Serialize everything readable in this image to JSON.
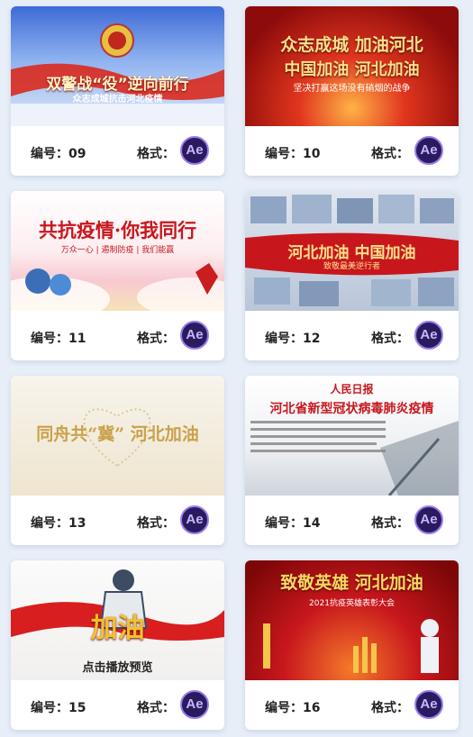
{
  "labels": {
    "number_prefix": "编号：",
    "format_label": "格式：",
    "format_badge": "Ae"
  },
  "cards": [
    {
      "number": "09",
      "thumb_title": "双警战“役”逆向前行",
      "thumb_sub": "众志成城抗击河北疫情"
    },
    {
      "number": "10",
      "thumb_title": "众志成城 加油河北",
      "thumb_title2": "中国加油 河北加油",
      "thumb_sub": "坚决打赢这场没有硝烟的战争"
    },
    {
      "number": "11",
      "thumb_title": "共抗疫情·你我同行",
      "thumb_sub": "万众一心 | 遏制防疫 | 我们能赢"
    },
    {
      "number": "12",
      "thumb_title": "河北加油 中国加油",
      "thumb_sub": "致敬最美逆行者"
    },
    {
      "number": "13",
      "thumb_title": "同舟共“冀” 河北加油",
      "thumb_sub": ""
    },
    {
      "number": "14",
      "thumb_title": "河北省新型冠状病毒肺炎疫情",
      "thumb_sub": "人民日报"
    },
    {
      "number": "15",
      "thumb_title": "加油",
      "thumb_sub": "点击播放预览"
    },
    {
      "number": "16",
      "thumb_title": "致敬英雄 河北加油",
      "thumb_sub": "2021抗疫英雄表彰大会"
    }
  ],
  "colors": {
    "accent_ae": "#9b7cf0",
    "ae_bg": "#2a1b5e",
    "page_bg": "#e7eef8"
  }
}
